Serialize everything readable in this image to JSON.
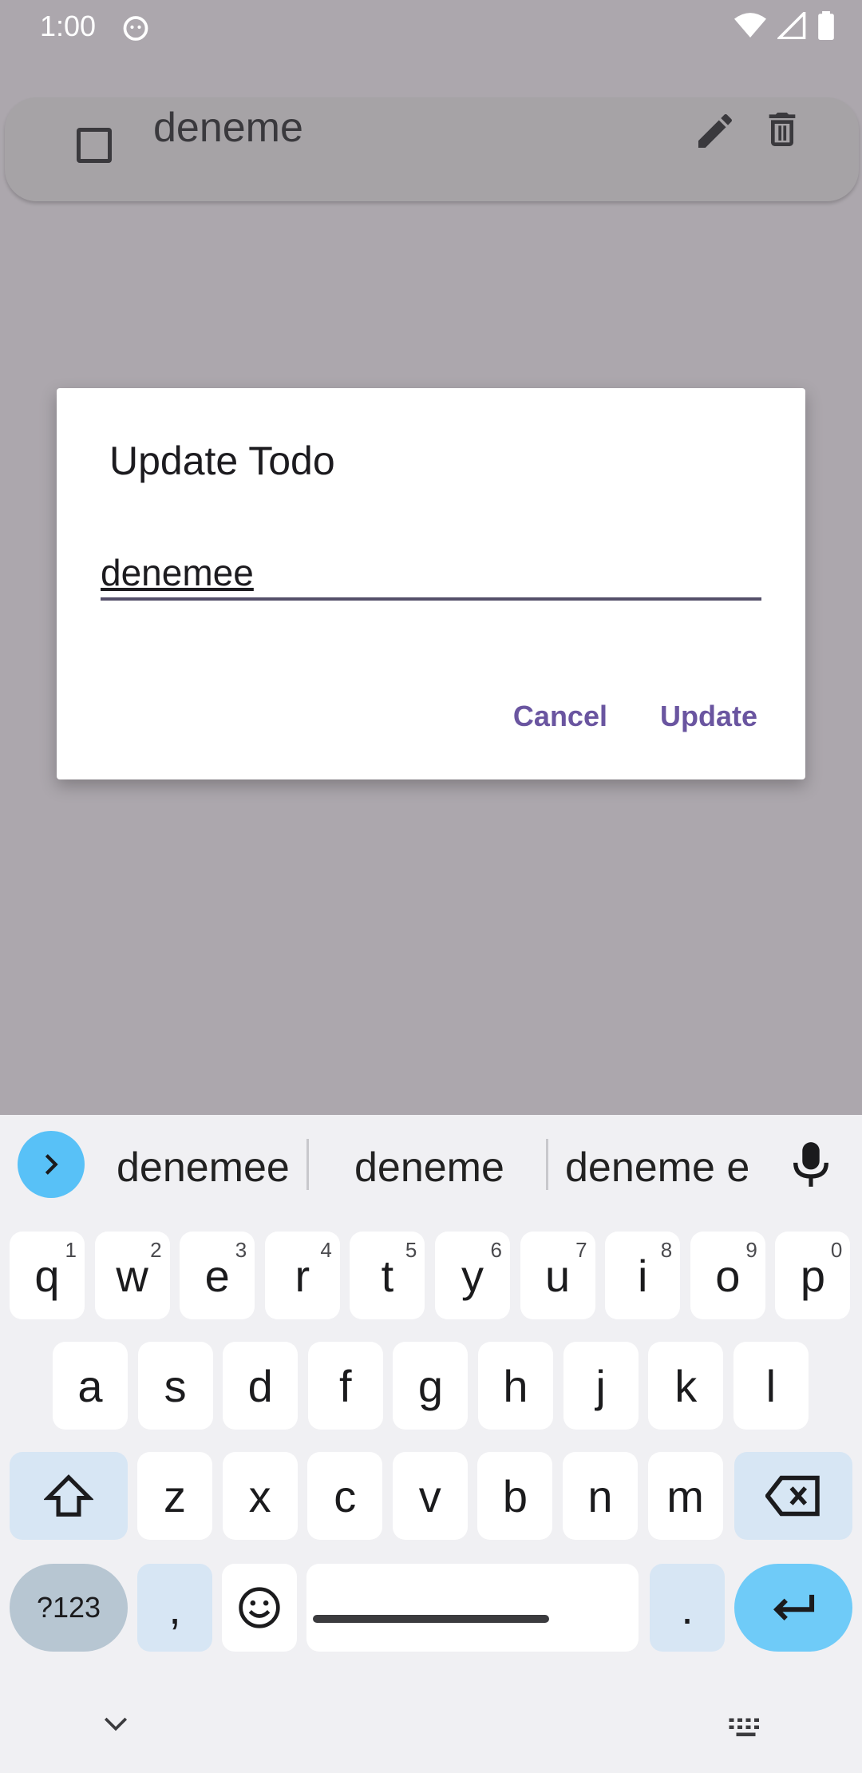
{
  "status_bar": {
    "time": "1:00"
  },
  "todo": {
    "text": "deneme"
  },
  "dialog": {
    "title": "Update Todo",
    "input_value": "denemee",
    "cancel_label": "Cancel",
    "update_label": "Update"
  },
  "keyboard": {
    "suggestions": [
      "denemee",
      "deneme",
      "deneme e"
    ],
    "row1": [
      {
        "key": "q",
        "hint": "1"
      },
      {
        "key": "w",
        "hint": "2"
      },
      {
        "key": "e",
        "hint": "3"
      },
      {
        "key": "r",
        "hint": "4"
      },
      {
        "key": "t",
        "hint": "5"
      },
      {
        "key": "y",
        "hint": "6"
      },
      {
        "key": "u",
        "hint": "7"
      },
      {
        "key": "i",
        "hint": "8"
      },
      {
        "key": "o",
        "hint": "9"
      },
      {
        "key": "p",
        "hint": "0"
      }
    ],
    "row2": [
      "a",
      "s",
      "d",
      "f",
      "g",
      "h",
      "j",
      "k",
      "l"
    ],
    "row3": [
      "z",
      "x",
      "c",
      "v",
      "b",
      "n",
      "m"
    ],
    "symbols_label": "?123",
    "comma": ",",
    "period": "."
  },
  "colors": {
    "accent": "#6a55a0",
    "scrim": "#aca7ad",
    "suggest_button": "#58c1f7",
    "enter_key": "#6fcbf8"
  }
}
